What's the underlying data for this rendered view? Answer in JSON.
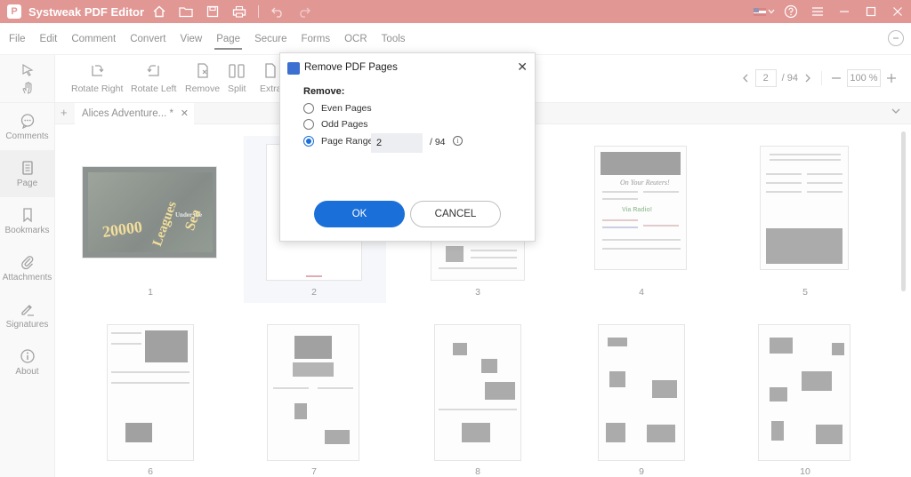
{
  "app": {
    "title": "Systweak PDF Editor",
    "logo": "P",
    "accent": "#c8423d"
  },
  "menu": [
    "File",
    "Edit",
    "Comment",
    "Convert",
    "View",
    "Page",
    "Secure",
    "Forms",
    "OCR",
    "Tools"
  ],
  "menu_active": "Page",
  "rail": [
    {
      "label": "Comments",
      "icon": "comment-icon"
    },
    {
      "label": "Page",
      "icon": "page-icon"
    },
    {
      "label": "Bookmarks",
      "icon": "bookmark-icon"
    },
    {
      "label": "Attachments",
      "icon": "attachment-icon"
    },
    {
      "label": "Signatures",
      "icon": "signature-icon"
    },
    {
      "label": "About",
      "icon": "info-icon"
    }
  ],
  "toolbar": {
    "tools": [
      "Rotate Right",
      "Rotate Left",
      "Remove",
      "Split",
      "Extra"
    ],
    "page_current": "2",
    "page_total": "/ 94",
    "zoom": "100 %"
  },
  "tab": {
    "name": "Alices Adventure... *"
  },
  "pages": [
    "1",
    "2",
    "3",
    "4",
    "5",
    "6",
    "7",
    "8",
    "9",
    "10"
  ],
  "page4_text": {
    "headline": "On Your Reuters!",
    "subhead": "Via Radio!"
  },
  "cover_text": {
    "line1": "20000",
    "line2": "Leagues",
    "line3": "Under the",
    "line4": "Sea"
  },
  "dialog": {
    "title": "Remove PDF Pages",
    "remove_label": "Remove:",
    "even": "Even Pages",
    "odd": "Odd Pages",
    "range_label": "Page Range:",
    "range_value": "2",
    "range_total": "/ 94",
    "ok": "OK",
    "cancel": "CANCEL",
    "selected": "range"
  }
}
